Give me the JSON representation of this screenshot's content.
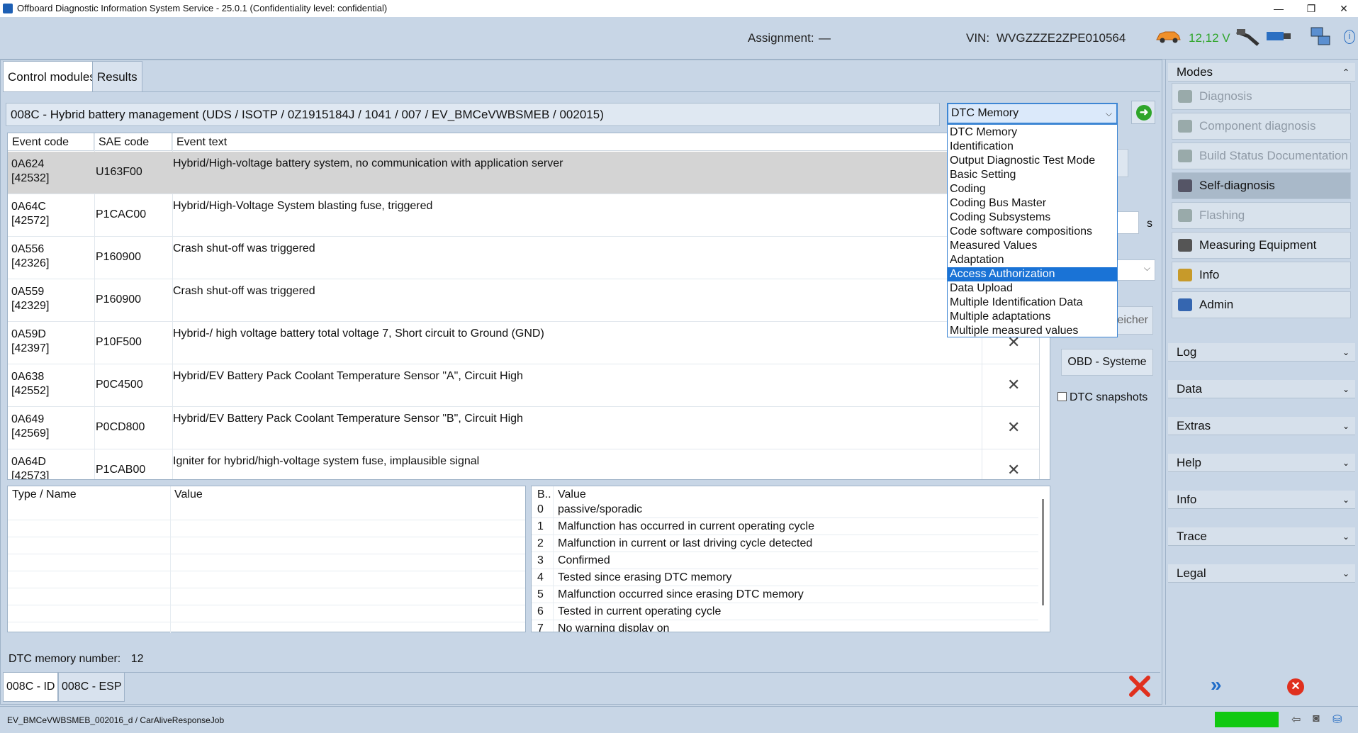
{
  "window": {
    "title": "Offboard Diagnostic Information System Service - 25.0.1 (Confidentiality level: confidential)",
    "min": "—",
    "max": "❐",
    "close": "✕"
  },
  "header": {
    "assignment_label": "Assignment:",
    "assignment_value": "—",
    "vin_label": "VIN:",
    "vin_value": "WVGZZZE2ZPE010564",
    "voltage": "12,12 V",
    "info": "i"
  },
  "tabs": [
    "Control modules",
    "Results"
  ],
  "module_field": "008C - Hybrid battery management  (UDS / ISOTP / 0Z1915184J / 1041 / 007 / EV_BMCeVWBSMEB / 002015)",
  "function_select": {
    "selected": "DTC Memory",
    "options": [
      "DTC Memory",
      "Identification",
      "Output Diagnostic Test Mode",
      "Basic Setting",
      "Coding",
      "Coding Bus Master",
      "Coding Subsystems",
      "Code software compositions",
      "Measured Values",
      "Adaptation",
      "Access Authorization",
      "Data Upload",
      "Multiple Identification Data",
      "Multiple adaptations",
      "Multiple measured values"
    ],
    "highlighted": "Access Authorization"
  },
  "event_table": {
    "headers": [
      "Event code",
      "SAE code",
      "Event text"
    ],
    "rows": [
      {
        "code": "0A624",
        "code2": "[42532]",
        "sae": "U163F00",
        "text": "Hybrid/High-voltage battery system, no communication with application server",
        "mark": ""
      },
      {
        "code": "0A64C",
        "code2": "[42572]",
        "sae": "P1CAC00",
        "text": "Hybrid/High-Voltage System blasting fuse, triggered",
        "mark": ""
      },
      {
        "code": "0A556",
        "code2": "[42326]",
        "sae": "P160900",
        "text": "Crash shut-off was triggered",
        "mark": ""
      },
      {
        "code": "0A559",
        "code2": "[42329]",
        "sae": "P160900",
        "text": "Crash shut-off was triggered",
        "mark": ""
      },
      {
        "code": "0A59D",
        "code2": "[42397]",
        "sae": "P10F500",
        "text": "Hybrid-/ high voltage battery total voltage 7, Short circuit to Ground (GND)",
        "mark": "✕"
      },
      {
        "code": "0A638",
        "code2": "[42552]",
        "sae": "P0C4500",
        "text": "Hybrid/EV Battery Pack Coolant Temperature Sensor \"A\", Circuit High",
        "mark": "✕"
      },
      {
        "code": "0A649",
        "code2": "[42569]",
        "sae": "P0CD800",
        "text": "Hybrid/EV Battery Pack Coolant Temperature Sensor \"B\", Circuit High",
        "mark": "✕"
      },
      {
        "code": "0A64D",
        "code2": "[42573]",
        "sae": "P1CAB00",
        "text": "Igniter for hybrid/high-voltage system fuse, implausible signal",
        "mark": "✕"
      }
    ]
  },
  "side_controls": {
    "unit": "s",
    "memory_btn": "eicher",
    "obd_button": "OBD - Systeme",
    "dtc_snapshots": "DTC snapshots"
  },
  "type_table": {
    "headers": [
      "Type / Name",
      "Value"
    ]
  },
  "bit_table": {
    "headers": [
      "B..",
      "Value"
    ],
    "rows": [
      {
        "b": "0",
        "v": "passive/sporadic"
      },
      {
        "b": "1",
        "v": "Malfunction has occurred in current operating cycle"
      },
      {
        "b": "2",
        "v": "Malfunction in current or last driving cycle detected"
      },
      {
        "b": "3",
        "v": "Confirmed"
      },
      {
        "b": "4",
        "v": "Tested since erasing DTC memory"
      },
      {
        "b": "5",
        "v": "Malfunction occurred since erasing DTC memory"
      },
      {
        "b": "6",
        "v": "Tested in current operating cycle"
      },
      {
        "b": "7",
        "v": "No warning display on"
      }
    ]
  },
  "dtc_count": {
    "label": "DTC memory number:",
    "value": "12"
  },
  "bottom_tabs": [
    "008C - ID",
    "008C - ESP"
  ],
  "sidebar": {
    "modes_label": "Modes",
    "modes": [
      {
        "label": "Diagnosis",
        "state": "disabled"
      },
      {
        "label": "Component diagnosis",
        "state": "disabled"
      },
      {
        "label": "Build Status Documentation",
        "state": "disabled"
      },
      {
        "label": "Self-diagnosis",
        "state": "active"
      },
      {
        "label": "Flashing",
        "state": "disabled"
      },
      {
        "label": "Measuring Equipment",
        "state": "enabled"
      },
      {
        "label": "Info",
        "state": "enabled"
      },
      {
        "label": "Admin",
        "state": "enabled"
      }
    ],
    "sections": [
      "Log",
      "Data",
      "Extras",
      "Help",
      "Info",
      "Trace",
      "Legal"
    ]
  },
  "statusbar": {
    "text": "EV_BMCeVWBSMEB_002016_d / CarAliveResponseJob",
    "indicator_color": "#11c911"
  },
  "colors": {
    "accent": "#1a73d6",
    "error": "#e0301e",
    "ok": "#2fa52a"
  }
}
